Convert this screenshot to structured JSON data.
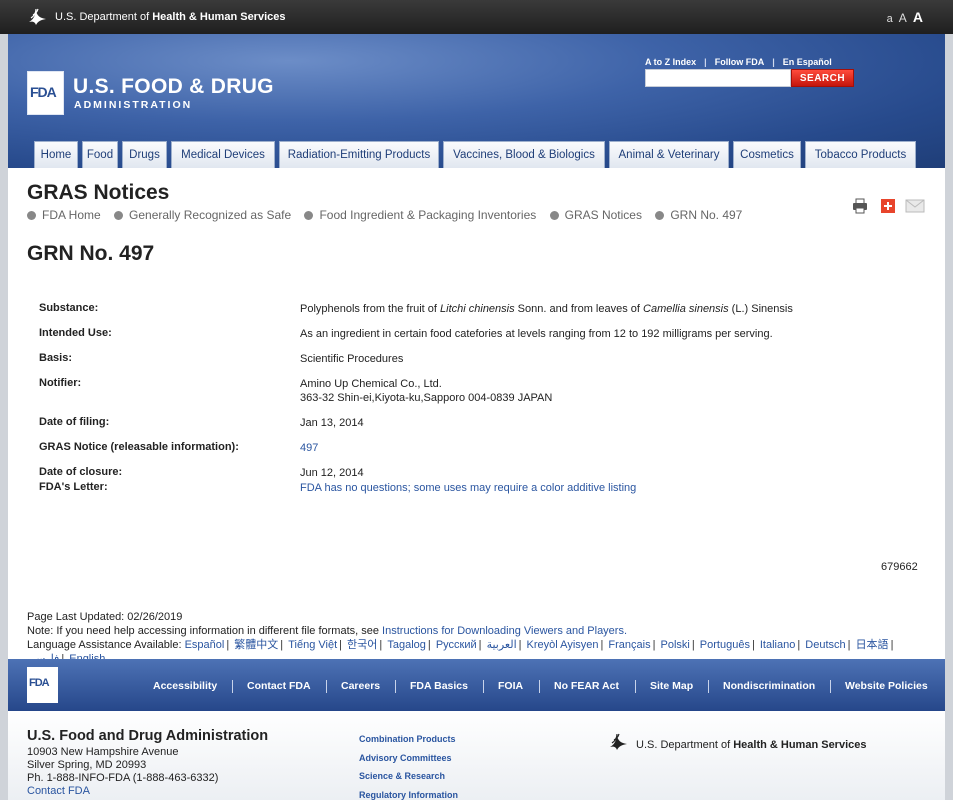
{
  "hhs_bar": {
    "prefix": "U.S. Department of",
    "name": "Health & Human Services",
    "text_size": [
      "a",
      "A",
      "A"
    ]
  },
  "header": {
    "logo": "FDA",
    "brand_line1": "U.S. FOOD & DRUG",
    "brand_line2": "ADMINISTRATION",
    "util_links": [
      "A to Z Index",
      "Follow FDA",
      "En Español"
    ],
    "search_placeholder": "",
    "search_button": "SEARCH"
  },
  "tabs": [
    "Home",
    "Food",
    "Drugs",
    "Medical Devices",
    "Radiation-Emitting Products",
    "Vaccines, Blood & Biologics",
    "Animal & Veterinary",
    "Cosmetics",
    "Tobacco Products"
  ],
  "page": {
    "title": "GRAS Notices",
    "breadcrumb": [
      "FDA Home",
      "Generally Recognized as Safe",
      "Food Ingredient & Packaging Inventories",
      "GRAS Notices",
      "GRN No. 497"
    ],
    "grn_title": "GRN No. 497"
  },
  "details": {
    "substance_label": "Substance:",
    "substance_pre": "Polyphenols from the fruit of ",
    "substance_italic1": "Litchi chinensis",
    "substance_mid": " Sonn. and from leaves of ",
    "substance_italic2": "Camellia sinensis",
    "substance_post": " (L.) Sinensis",
    "intended_use_label": "Intended Use:",
    "intended_use": "As an ingredient in certain food catefories at levels ranging from 12 to 192 milligrams per serving.",
    "basis_label": "Basis:",
    "basis": "Scientific Procedures",
    "notifier_label": "Notifier:",
    "notifier_name": "Amino Up Chemical Co., Ltd.",
    "notifier_address": "363-32 Shin-ei,Kiyota-ku,Sapporo 004-0839 JAPAN",
    "filing_label": "Date of filing:",
    "filing_date": "Jan 13, 2014",
    "notice_label": "GRAS Notice (releasable information):",
    "notice_link": "497",
    "closure_label": "Date of closure:",
    "closure_date": "Jun 12, 2014",
    "letter_label": "FDA's Letter:",
    "letter_link": "FDA has no questions; some uses may require a color additive listing"
  },
  "record_id": "679662",
  "notes": {
    "updated": "Page Last Updated: 02/26/2019",
    "format_note": "Note: If you need help accessing information in different file formats, see ",
    "format_link": "Instructions for Downloading Viewers and Players.",
    "lang_label": "Language Assistance Available: ",
    "languages": [
      "Español",
      "繁體中文",
      "Tiếng Việt",
      "한국어",
      "Tagalog",
      "Русский",
      "العربية",
      "Kreyòl Ayisyen",
      "Français",
      "Polski",
      "Português",
      "Italiano",
      "Deutsch",
      "日本語",
      "فارسی",
      "English"
    ]
  },
  "footer_nav": {
    "logo": "FDA",
    "links": [
      "Accessibility",
      "Contact FDA",
      "Careers",
      "FDA Basics",
      "FOIA",
      "No FEAR Act",
      "Site Map",
      "Nondiscrimination",
      "Website Policies"
    ]
  },
  "footer": {
    "org_name": "U.S. Food and Drug Administration",
    "address_1": "10903 New Hampshire Avenue",
    "address_2": "Silver Spring, MD 20993",
    "phone": "Ph. 1-888-INFO-FDA (1-888-463-6332)",
    "contact_link": "Contact FDA",
    "quick_links": [
      "Combination Products",
      "Advisory Committees",
      "Science & Research",
      "Regulatory Information"
    ],
    "hhs_prefix": "U.S. Department of",
    "hhs_name": "Health & Human Services"
  },
  "colors": {
    "header_blue": "#274a8c",
    "link_blue": "#2a55a0",
    "search_red": "#e0281c"
  }
}
